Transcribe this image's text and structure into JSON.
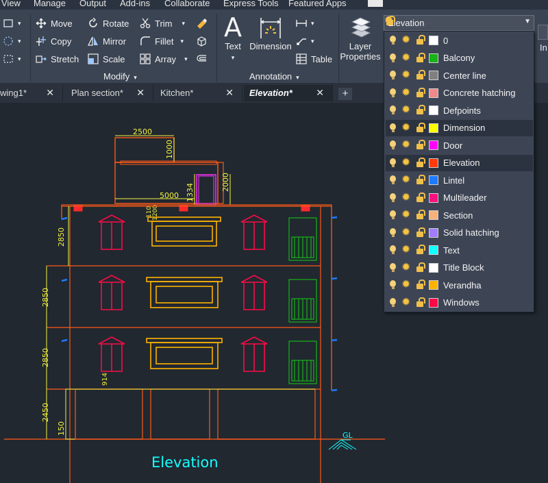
{
  "menu": [
    "View",
    "Manage",
    "Output",
    "Add-ins",
    "Collaborate",
    "Express Tools",
    "Featured Apps"
  ],
  "ribbon": {
    "modify": {
      "title": "Modify",
      "tools": [
        "Move",
        "Rotate",
        "Trim",
        "Copy",
        "Mirror",
        "Fillet",
        "Stretch",
        "Scale",
        "Array"
      ]
    },
    "annotation": {
      "title": "Annotation",
      "text_label": "Text",
      "dimension_label": "Dimension",
      "table_label": "Table"
    },
    "layers": {
      "properties_label_1": "Layer",
      "properties_label_2": "Properties",
      "current_layer": "Elevation",
      "current_color": "#ff3b0b",
      "right_cut_label": "In"
    }
  },
  "tabs": [
    {
      "label": "wing1*",
      "active": false
    },
    {
      "label": "Plan section*",
      "active": false
    },
    {
      "label": "Kitchen*",
      "active": false
    },
    {
      "label": "Elevation*",
      "active": true
    }
  ],
  "tabs_add_label": "+",
  "layers_list": [
    {
      "name": "0",
      "color": "#ffffff"
    },
    {
      "name": "Balcony",
      "color": "#17b317"
    },
    {
      "name": "Center line",
      "color": "#808080"
    },
    {
      "name": "Concrete hatching",
      "color": "#f08a8a"
    },
    {
      "name": "Defpoints",
      "color": "#ffffff"
    },
    {
      "name": "Dimension",
      "color": "#ffff00"
    },
    {
      "name": "Door",
      "color": "#ff00ff"
    },
    {
      "name": "Elevation",
      "color": "#ff3b0b"
    },
    {
      "name": "Lintel",
      "color": "#1e7bff"
    },
    {
      "name": "Multileader",
      "color": "#ff1080"
    },
    {
      "name": "Section",
      "color": "#f6b27c"
    },
    {
      "name": "Solid hatching",
      "color": "#a17cff"
    },
    {
      "name": "Text",
      "color": "#14ffff"
    },
    {
      "name": "Title Block",
      "color": "#ffffff"
    },
    {
      "name": "Verandha",
      "color": "#ffb300"
    },
    {
      "name": "Windows",
      "color": "#ff0a46"
    }
  ],
  "drawing": {
    "title": "Elevation",
    "ground_label": "GL",
    "dims": {
      "top_width": "2500",
      "top_height": "1000",
      "stair_width": "5000",
      "stair_height": "1334",
      "stair_tower": "2000",
      "floor1": "2850",
      "floor2": "2850",
      "floor3": "2850",
      "ground": "2450",
      "plinth": "150",
      "sill": "914",
      "parapet_a": "110",
      "parapet_b": "1200"
    }
  }
}
